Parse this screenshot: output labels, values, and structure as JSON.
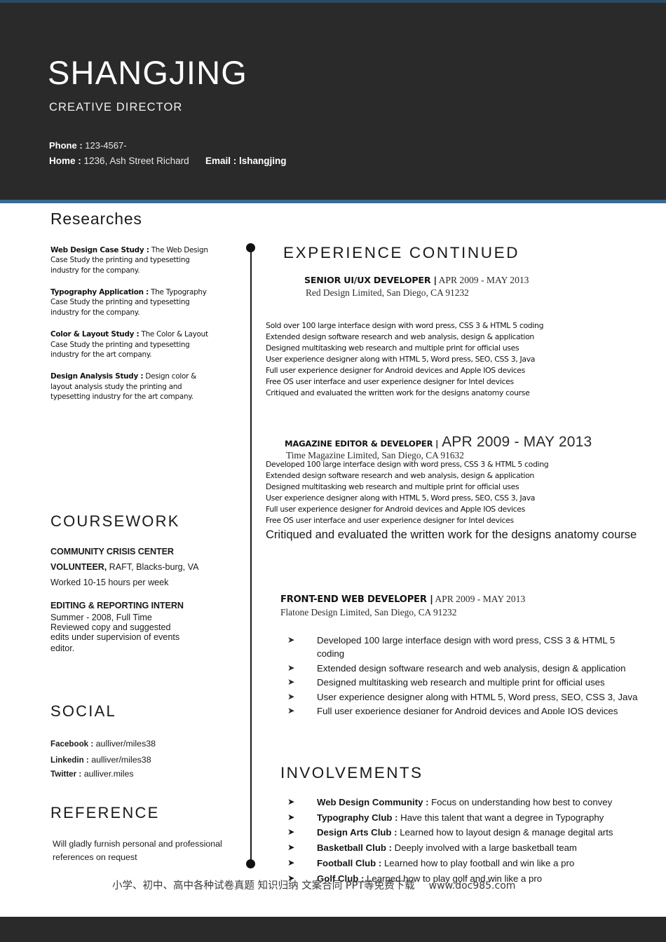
{
  "colors": {
    "header_bg": "#2a2a2a",
    "accent_line": "#3a6a93",
    "top_strip": "#2b4b63",
    "text": "#1a1a1a",
    "footer_bar": "#2a2a2a"
  },
  "header": {
    "name": "SHANGJING",
    "role": "CREATIVE DIRECTOR",
    "phone_label": "Phone :",
    "phone_value": "123-4567-",
    "home_label": "Home :",
    "home_value": "1236, Ash Street Richard",
    "email": "Email : lshangjing"
  },
  "left": {
    "researches": {
      "title": "Researches",
      "items": [
        {
          "label": "Web Design Case Study :",
          "text": "The Web Design Case Study the printing and typesetting industry for the company."
        },
        {
          "label": "Typography Application :",
          "text": "The Typography Case Study the printing and typesetting industry for the company."
        },
        {
          "label": "Color & Layout Study :",
          "text": "The Color & Layout Case Study the printing and typesetting industry for the art company."
        },
        {
          "label": "Design Analysis Study :",
          "text": "Design color & layout analysis study the printing and typesetting industry for the art company."
        }
      ]
    },
    "coursework": {
      "title": "COURSEWORK",
      "entry1_line1": "COMMUNITY CRISIS CENTER",
      "entry1_line2_bold": "VOLUNTEER,",
      "entry1_line2_rest": " RAFT, Blacks-burg, VA",
      "entry1_line3": "Worked 10-15 hours per week",
      "entry2_title": "EDITING & REPORTING INTERN",
      "entry2_line1": "Summer - 2008, Full Time",
      "entry2_line2": "Reviewed copy and suggested",
      "entry2_line3": "edits under supervision of events",
      "entry2_line4_clipped": "editor."
    },
    "social": {
      "title": "SOCIAL",
      "rows": [
        {
          "label": "Facebook :",
          "value": "aulliver/miles38"
        },
        {
          "label": "Linkedin :",
          "value": "aulliver/miles38"
        },
        {
          "label": "Twitter :",
          "value": "aulliver.miles"
        }
      ]
    },
    "reference": {
      "title": "REFERENCE",
      "body": "Will gladly furnish personal and professional references on request"
    }
  },
  "right": {
    "section_title": "EXPERIENCE CONTINUED",
    "jobs": [
      {
        "title": "SENIOR UI/UX DEVELOPER |",
        "dates": " APR 2009 - MAY 2013",
        "company": "Red Design Limited, San Diego, CA 91232",
        "bullets": [
          "Sold over 100 large interface design with word press, CSS 3 & HTML 5 coding",
          "Extended design software research and web analysis, design & application",
          "Designed multitasking web research and multiple print for official uses",
          "User experience designer along with HTML 5, Word press, SEO, CSS 3, Java",
          "Full user experience designer for Android devices and Apple IOS devices",
          "Free OS user interface and user experience designer for Intel devices",
          "Critiqued and evaluated the written work for the designs anatomy course"
        ]
      },
      {
        "title": "MAGAZINE EDITOR & DEVELOPER |",
        "dates": " APR 2009 - MAY 2013",
        "company": "Time Magazine Limited, San Diego, CA 91632",
        "bullets": [
          "Developed 100 large interface design with word press, CSS 3 & HTML 5 coding",
          "Extended design software research and web analysis, design & application",
          "Designed multitasking web research and multiple print for official uses",
          "User experience designer along with HTML 5, Word press, SEO, CSS 3, Java",
          "Full user experience designer for Android devices and Apple IOS devices",
          "Free OS user interface and user experience designer for Intel devices"
        ],
        "last_bullet_large": "Critiqued and evaluated the written work for the designs anatomy course"
      },
      {
        "title": "FRONT-END WEB DEVELOPER |",
        "dates": " APR 2009 - MAY 2013",
        "company": "Flatone Design Limited, San Diego, CA 91232",
        "bullets": [
          "Developed 100 large interface design with word press, CSS 3 & HTML 5 coding",
          "Extended design software research and web analysis, design & application",
          "Designed multitasking web research and multiple print for official uses",
          "User experience designer along with HTML 5, Word press, SEO, CSS 3, Java"
        ],
        "clipped_bullet": "Full user experience designer for Android devices and Apple IOS devices"
      }
    ],
    "involvements": {
      "title": "INVOLVEMENTS",
      "items": [
        {
          "label": "Web Design Community :",
          "text": " Focus on understanding how best to convey"
        },
        {
          "label": "Typography Club :",
          "text": " Have this talent that want a degree in Typography"
        },
        {
          "label": "Design Arts Club :",
          "text": " Learned how to layout design & manage degital arts"
        },
        {
          "label": "Basketball Club :",
          "text": " Deeply involved with a large basketball team"
        },
        {
          "label": "Football Club :",
          "text": " Learned how to play football and win like a pro"
        },
        {
          "label": "Golf Club :",
          "text": " Learned how to play golf and win like a pro"
        }
      ]
    }
  },
  "watermark": {
    "text": "小学、初中、高中各种试卷真题 知识归纳 文案合同 PPT等免费下载",
    "url": "www.doc985.com"
  },
  "icons": {
    "bullet_arrow": "➤",
    "timeline_dot": "timeline-dot"
  }
}
